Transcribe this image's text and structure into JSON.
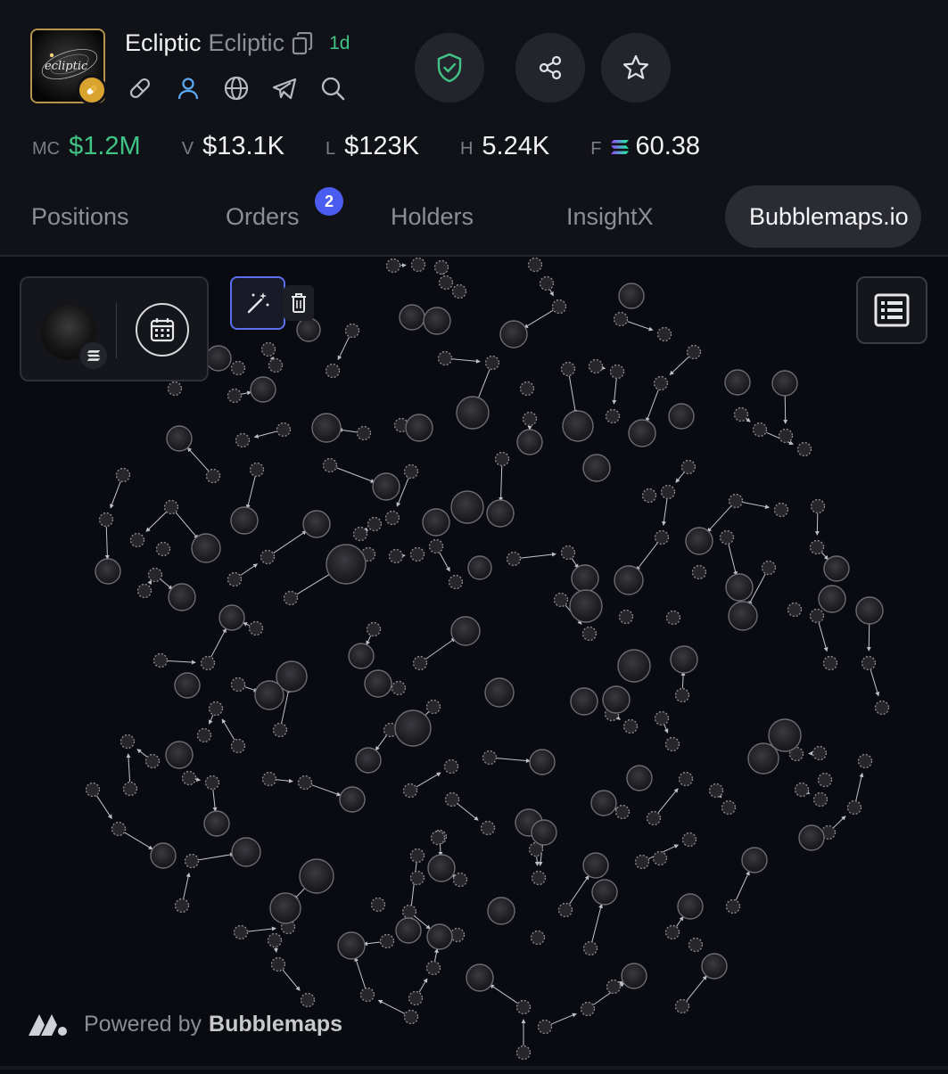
{
  "token": {
    "name": "Ecliptic",
    "ticker": "Ecliptic",
    "age": "1d",
    "logo_text": "ecliptic"
  },
  "stats": [
    {
      "label": "MC",
      "value": "$1.2M",
      "accent": true
    },
    {
      "label": "V",
      "value": "$13.1K"
    },
    {
      "label": "L",
      "value": "$123K"
    },
    {
      "label": "H",
      "value": "5.24K"
    },
    {
      "label": "F",
      "value": "60.38",
      "icon": "solana-icon"
    }
  ],
  "tabs": [
    {
      "label": "Positions"
    },
    {
      "label": "Orders",
      "badge": "2"
    },
    {
      "label": "Holders"
    },
    {
      "label": "InsightX"
    },
    {
      "label": "Bubblemaps.io",
      "active": true
    }
  ],
  "footer": {
    "powered_label": "Powered by",
    "brand": "Bubblemaps"
  },
  "colors": {
    "accent_green": "#3fc486",
    "badge_blue": "#4a5df0",
    "selected_blue": "#5b6ff0",
    "shield_green": "#3fc486",
    "user_blue": "#5aa8f0"
  },
  "icons": [
    "copy-icon",
    "pill-icon",
    "user-icon",
    "globe-icon",
    "telegram-icon",
    "search-icon",
    "shield-check-icon",
    "share-icon",
    "star-icon",
    "calendar-icon",
    "magic-wand-icon",
    "trash-icon",
    "list-icon",
    "solana-icon",
    "bubblemaps-logo-icon"
  ]
}
